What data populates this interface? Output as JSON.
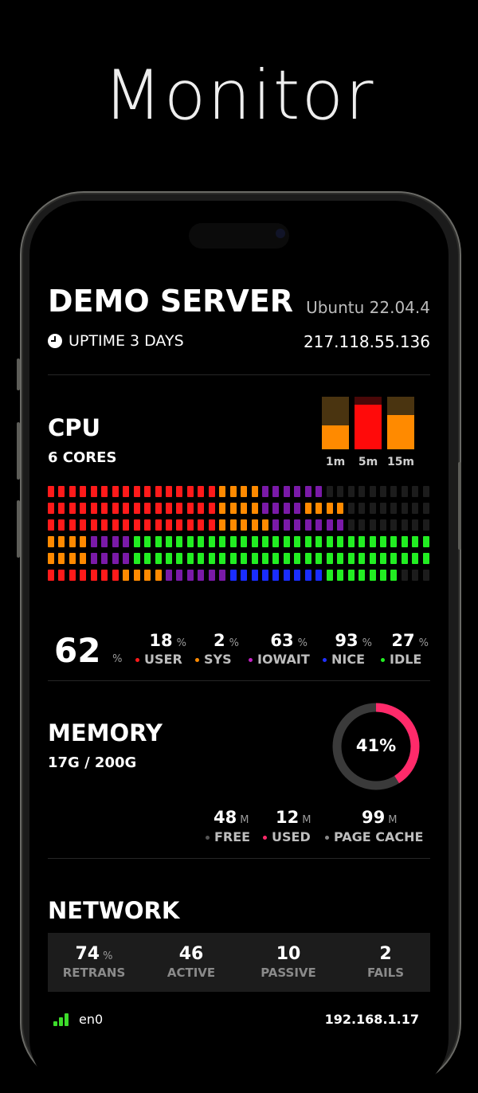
{
  "hero": {
    "title": "Monitor"
  },
  "server": {
    "name": "DEMO SERVER",
    "os": "Ubuntu 22.04.4",
    "uptime": "UPTIME 3 DAYS",
    "ip": "217.118.55.136"
  },
  "cpu": {
    "title": "CPU",
    "subtitle": "6 CORES",
    "load": [
      {
        "label": "1m",
        "value": 0.45
      },
      {
        "label": "5m",
        "value": 0.85
      },
      {
        "label": "15m",
        "value": 0.65
      }
    ],
    "total": "62",
    "total_unit": "%",
    "stats": [
      {
        "value": "18",
        "unit": "%",
        "label": "USER",
        "color": "#ff1a1a"
      },
      {
        "value": "2",
        "unit": "%",
        "label": "SYS",
        "color": "#ff8a00"
      },
      {
        "value": "63",
        "unit": "%",
        "label": "IOWAIT",
        "color": "#c020c0"
      },
      {
        "value": "93",
        "unit": "%",
        "label": "NICE",
        "color": "#2030ff"
      },
      {
        "value": "27",
        "unit": "%",
        "label": "IDLE",
        "color": "#22ee22"
      }
    ],
    "cores": [
      [
        "r",
        "r",
        "r",
        "r",
        "r",
        "r",
        "r",
        "r",
        "r",
        "r",
        "r",
        "r",
        "r",
        "r",
        "r",
        "r",
        "o",
        "o",
        "o",
        "o",
        "p",
        "p",
        "p",
        "p",
        "p",
        "p",
        "e",
        "e",
        "e",
        "e",
        "e",
        "e",
        "e",
        "e",
        "e",
        "e"
      ],
      [
        "r",
        "r",
        "r",
        "r",
        "r",
        "r",
        "r",
        "r",
        "r",
        "r",
        "r",
        "r",
        "r",
        "r",
        "r",
        "r",
        "o",
        "o",
        "o",
        "o",
        "p",
        "p",
        "p",
        "p",
        "o",
        "o",
        "o",
        "o",
        "e",
        "e",
        "e",
        "e",
        "e",
        "e",
        "e",
        "e"
      ],
      [
        "r",
        "r",
        "r",
        "r",
        "r",
        "r",
        "r",
        "r",
        "r",
        "r",
        "r",
        "r",
        "r",
        "r",
        "r",
        "r",
        "o",
        "o",
        "o",
        "o",
        "o",
        "p",
        "p",
        "p",
        "p",
        "p",
        "p",
        "p",
        "e",
        "e",
        "e",
        "e",
        "e",
        "e",
        "e",
        "e"
      ],
      [
        "o",
        "o",
        "o",
        "o",
        "p",
        "p",
        "p",
        "p",
        "g",
        "g",
        "g",
        "g",
        "g",
        "g",
        "g",
        "g",
        "g",
        "g",
        "g",
        "g",
        "g",
        "g",
        "g",
        "g",
        "g",
        "g",
        "g",
        "g",
        "g",
        "g",
        "g",
        "g",
        "g",
        "g",
        "g",
        "g"
      ],
      [
        "o",
        "o",
        "o",
        "o",
        "p",
        "p",
        "p",
        "p",
        "g",
        "g",
        "g",
        "g",
        "g",
        "g",
        "g",
        "g",
        "g",
        "g",
        "g",
        "g",
        "g",
        "g",
        "g",
        "g",
        "g",
        "g",
        "g",
        "g",
        "g",
        "g",
        "g",
        "g",
        "g",
        "g",
        "g",
        "g"
      ],
      [
        "r",
        "r",
        "r",
        "r",
        "r",
        "r",
        "r",
        "o",
        "o",
        "o",
        "o",
        "p",
        "p",
        "p",
        "p",
        "p",
        "p",
        "b",
        "b",
        "b",
        "b",
        "b",
        "b",
        "b",
        "b",
        "b",
        "g",
        "g",
        "g",
        "g",
        "g",
        "g",
        "g",
        "e",
        "e",
        "e"
      ]
    ],
    "colors": {
      "r": "#ff1a1a",
      "o": "#ff8a00",
      "p": "#7a1aa8",
      "b": "#1a2dff",
      "g": "#22ee22",
      "e": "#1c1c1c"
    }
  },
  "memory": {
    "title": "MEMORY",
    "subtitle": "17G / 200G",
    "percent": "41%",
    "used_fraction": 0.41,
    "stats": [
      {
        "value": "48",
        "unit": "M",
        "label": "FREE",
        "color": "#555555"
      },
      {
        "value": "12",
        "unit": "M",
        "label": "USED",
        "color": "#ff2a6a"
      },
      {
        "value": "99",
        "unit": "M",
        "label": "PAGE CACHE",
        "color": "#888888"
      }
    ]
  },
  "network": {
    "title": "NETWORK",
    "stats": [
      {
        "value": "74",
        "unit": "%",
        "label": "RETRANS"
      },
      {
        "value": "46",
        "unit": "",
        "label": "ACTIVE"
      },
      {
        "value": "10",
        "unit": "",
        "label": "PASSIVE"
      },
      {
        "value": "2",
        "unit": "",
        "label": "FAILS"
      }
    ],
    "interface": {
      "name": "en0",
      "ip": "192.168.1.17"
    }
  }
}
